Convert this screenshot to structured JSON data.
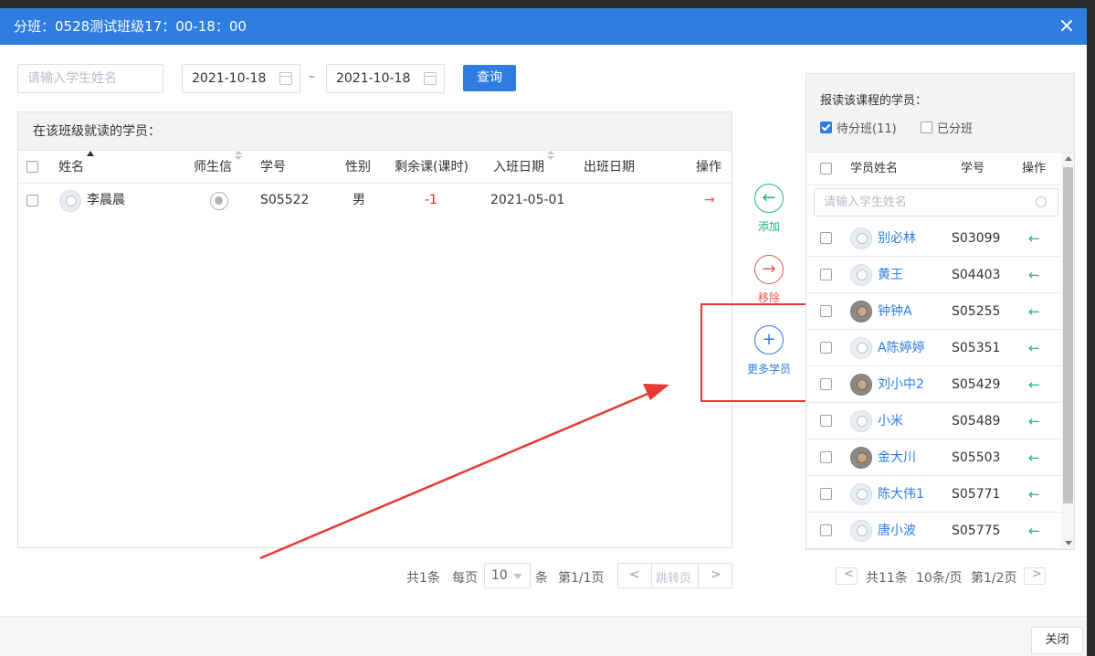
{
  "header": {
    "title": "分班：0528测试班级17：00-18：00",
    "close_icon": "×"
  },
  "filters": {
    "name_placeholder": "请输入学生姓名",
    "date_from": "2021-10-18",
    "date_sep": "–",
    "date_to": "2021-10-18",
    "query_label": "查询"
  },
  "left": {
    "title": "在该班级就读的学员：",
    "columns": [
      "姓名",
      "师生信",
      "学号",
      "性别",
      "剩余课(课时)",
      "入班日期",
      "出班日期",
      "操作"
    ],
    "rows": [
      {
        "name": "李晨晨",
        "id": "S05522",
        "gender": "男",
        "remaining": "-1",
        "join_date": "2021-05-01",
        "leave_date": "",
        "action_icon": "→"
      }
    ],
    "pager": {
      "total": "共1条",
      "per_page_label": "每页",
      "per_page": "10",
      "unit": "条",
      "page": "第1/1页",
      "jump": "跳转页",
      "prev": "<",
      "next": ">"
    }
  },
  "middle": {
    "add_icon": "←",
    "add_label": "添加",
    "remove_icon": "→",
    "remove_label": "移除",
    "more_icon": "+",
    "more_label": "更多学员"
  },
  "right": {
    "title": "报读该课程的学员：",
    "filter_pending": "待分班(11)",
    "filter_assigned": "已分班",
    "columns": [
      "学员姓名",
      "学号",
      "操作"
    ],
    "search_placeholder": "请输入学生姓名",
    "rows": [
      {
        "name": "别必林",
        "id": "S03099",
        "avatar": "light"
      },
      {
        "name": "黄王",
        "id": "S04403",
        "avatar": "light"
      },
      {
        "name": "钟钟A",
        "id": "S05255",
        "avatar": "dark"
      },
      {
        "name": "A陈婷婷",
        "id": "S05351",
        "avatar": "light"
      },
      {
        "name": "刘小中2",
        "id": "S05429",
        "avatar": "dark"
      },
      {
        "name": "小米",
        "id": "S05489",
        "avatar": "light"
      },
      {
        "name": "金大川",
        "id": "S05503",
        "avatar": "dark"
      },
      {
        "name": "陈大伟1",
        "id": "S05771",
        "avatar": "light"
      },
      {
        "name": "唐小波",
        "id": "S05775",
        "avatar": "light"
      }
    ],
    "action_icon": "←",
    "pager": {
      "prev": "<",
      "total": "共11条",
      "per_page": "10条/页",
      "page": "第1/2页",
      "next": ">"
    }
  },
  "footer": {
    "close_label": "关闭"
  },
  "colors": {
    "primary": "#2f7de1",
    "add": "#21b573",
    "remove": "#e35a4f",
    "highlight": "#e53935"
  }
}
